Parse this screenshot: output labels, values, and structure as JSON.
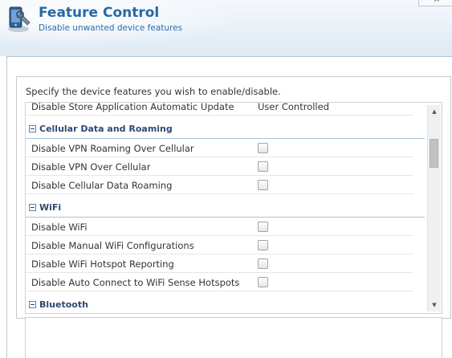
{
  "header": {
    "title": "Feature Control",
    "subtitle": "Disable unwanted device features",
    "icon": "device-wrench-icon",
    "close_label": "×"
  },
  "panel": {
    "instructions": "Specify the device features you wish to enable/disable."
  },
  "rows": {
    "partial_row": {
      "label": "Disable Store Application Automatic Update",
      "value": "User Controlled"
    },
    "sections": [
      {
        "title": "Cellular Data and Roaming",
        "items": [
          {
            "label": "Disable VPN Roaming Over Cellular",
            "checked": false
          },
          {
            "label": "Disable VPN Over Cellular",
            "checked": false
          },
          {
            "label": "Disable Cellular Data Roaming",
            "checked": false
          }
        ]
      },
      {
        "title": "WiFi",
        "items": [
          {
            "label": "Disable WiFi",
            "checked": false
          },
          {
            "label": "Disable Manual WiFi Configurations",
            "checked": false
          },
          {
            "label": "Disable WiFi Hotspot Reporting",
            "checked": false
          },
          {
            "label": "Disable Auto Connect to WiFi Sense Hotspots",
            "checked": false
          }
        ]
      },
      {
        "title": "Bluetooth",
        "items": []
      }
    ]
  },
  "scrollbar": {
    "up_glyph": "▲",
    "down_glyph": "▼"
  },
  "colors": {
    "title": "#2867a6",
    "section": "#2c4a73",
    "accent": "#a8c3dc"
  }
}
